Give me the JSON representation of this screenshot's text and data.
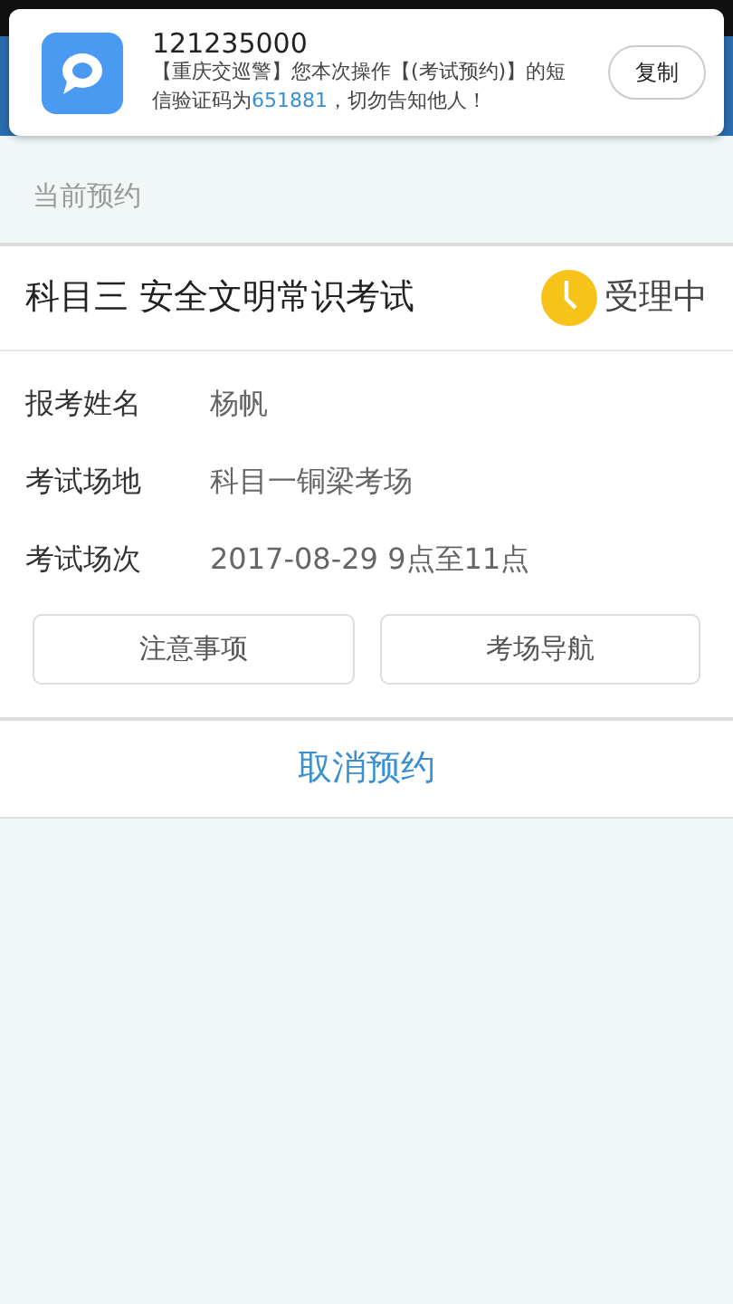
{
  "notification": {
    "sender": "121235000",
    "message_parts": [
      {
        "text": "【重庆交巡警】您本次操作【(考试预约)】的短信验证码为",
        "highlight": false
      },
      {
        "text": "651881",
        "highlight": true
      },
      {
        "text": "，切勿告知他人！",
        "highlight": false
      }
    ],
    "button": "复制"
  },
  "section_label": "当前预约",
  "appointment": {
    "title": "科目三 安全文明常识考试",
    "status": "受理中",
    "fields": [
      {
        "label": "报考姓名",
        "value": "杨帆"
      },
      {
        "label": "考试场地",
        "value": "科目一铜梁考场"
      },
      {
        "label": "考试场次",
        "value": "2017-08-29  9点至11点"
      }
    ],
    "buttons": [
      "注意事项",
      "考场导航"
    ],
    "cancel": "取消预约"
  }
}
